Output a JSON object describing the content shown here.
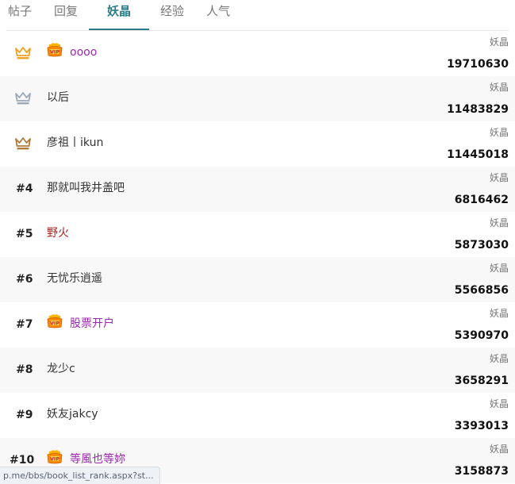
{
  "tabs": [
    {
      "label": "帖子",
      "active": false
    },
    {
      "label": "回复",
      "active": false
    },
    {
      "label": "妖晶",
      "active": true
    },
    {
      "label": "经验",
      "active": false
    },
    {
      "label": "人气",
      "active": false
    }
  ],
  "colors": {
    "accent": "#2a7d87",
    "gold": "#f0a020",
    "silver": "#9aa8b8",
    "bronze": "#b07a3a",
    "purple_name": "#9c27b0",
    "red_name": "#b22222"
  },
  "rows": [
    {
      "rank": "1",
      "badge": "gold-crown-icon",
      "vip": true,
      "name": "oooo",
      "name_color": "#9c27b0",
      "stat_label": "妖晶",
      "value": "19710630"
    },
    {
      "rank": "2",
      "badge": "silver-crown-icon",
      "vip": false,
      "name": "以后",
      "name_color": "#333333",
      "stat_label": "妖晶",
      "value": "11483829"
    },
    {
      "rank": "3",
      "badge": "bronze-crown-icon",
      "vip": false,
      "name": "彦祖丨ikun",
      "name_color": "#333333",
      "stat_label": "妖晶",
      "value": "11445018"
    },
    {
      "rank": "#4",
      "badge": null,
      "vip": false,
      "name": "那就叫我井盖吧",
      "name_color": "#333333",
      "stat_label": "妖晶",
      "value": "6816462"
    },
    {
      "rank": "#5",
      "badge": null,
      "vip": false,
      "name": "野火",
      "name_color": "#b22222",
      "stat_label": "妖晶",
      "value": "5873030"
    },
    {
      "rank": "#6",
      "badge": null,
      "vip": false,
      "name": "无忧乐逍遥",
      "name_color": "#333333",
      "stat_label": "妖晶",
      "value": "5566856"
    },
    {
      "rank": "#7",
      "badge": null,
      "vip": true,
      "name": "股票开户",
      "name_color": "#9c27b0",
      "stat_label": "妖晶",
      "value": "5390970"
    },
    {
      "rank": "#8",
      "badge": null,
      "vip": false,
      "name": "龙少c",
      "name_color": "#333333",
      "stat_label": "妖晶",
      "value": "3658291"
    },
    {
      "rank": "#9",
      "badge": null,
      "vip": false,
      "name": "妖友jakcy",
      "name_color": "#333333",
      "stat_label": "妖晶",
      "value": "3393013"
    },
    {
      "rank": "#10",
      "badge": null,
      "vip": true,
      "name": "等風也等妳",
      "name_color": "#9c27b0",
      "stat_label": "妖晶",
      "value": "3158873"
    }
  ],
  "status_url": "p.me/bbs/book_list_rank.aspx?st..."
}
